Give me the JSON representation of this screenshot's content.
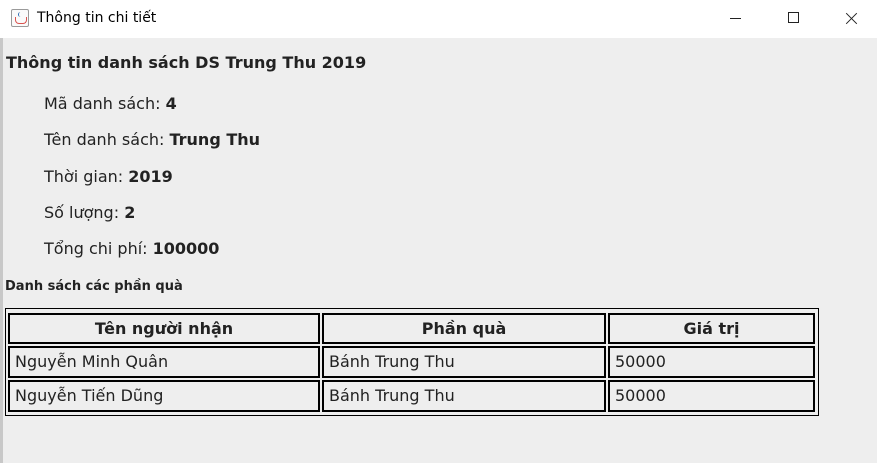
{
  "window": {
    "title": "Thông tin chi tiết"
  },
  "heading": "Thông tin danh sách DS Trung Thu 2019",
  "details": [
    {
      "label": "Mã danh sách: ",
      "value": "4"
    },
    {
      "label": "Tên danh sách: ",
      "value": "Trung Thu"
    },
    {
      "label": "Thời gian: ",
      "value": "2019"
    },
    {
      "label": "Số lượng: ",
      "value": "2"
    },
    {
      "label": "Tổng chi phí: ",
      "value": "100000"
    }
  ],
  "gifts_heading": "Danh sách các phần quà",
  "table": {
    "headers": [
      "Tên người nhận",
      "Phần quà",
      "Giá trị"
    ],
    "rows": [
      [
        "Nguyễn Minh Quân",
        "Bánh Trung Thu",
        "50000"
      ],
      [
        "Nguyễn Tiến Dũng",
        "Bánh Trung Thu",
        "50000"
      ]
    ]
  },
  "icons": {
    "app": "java-cup-icon",
    "minimize": "minimize-icon",
    "maximize": "maximize-icon",
    "close": "close-icon"
  }
}
